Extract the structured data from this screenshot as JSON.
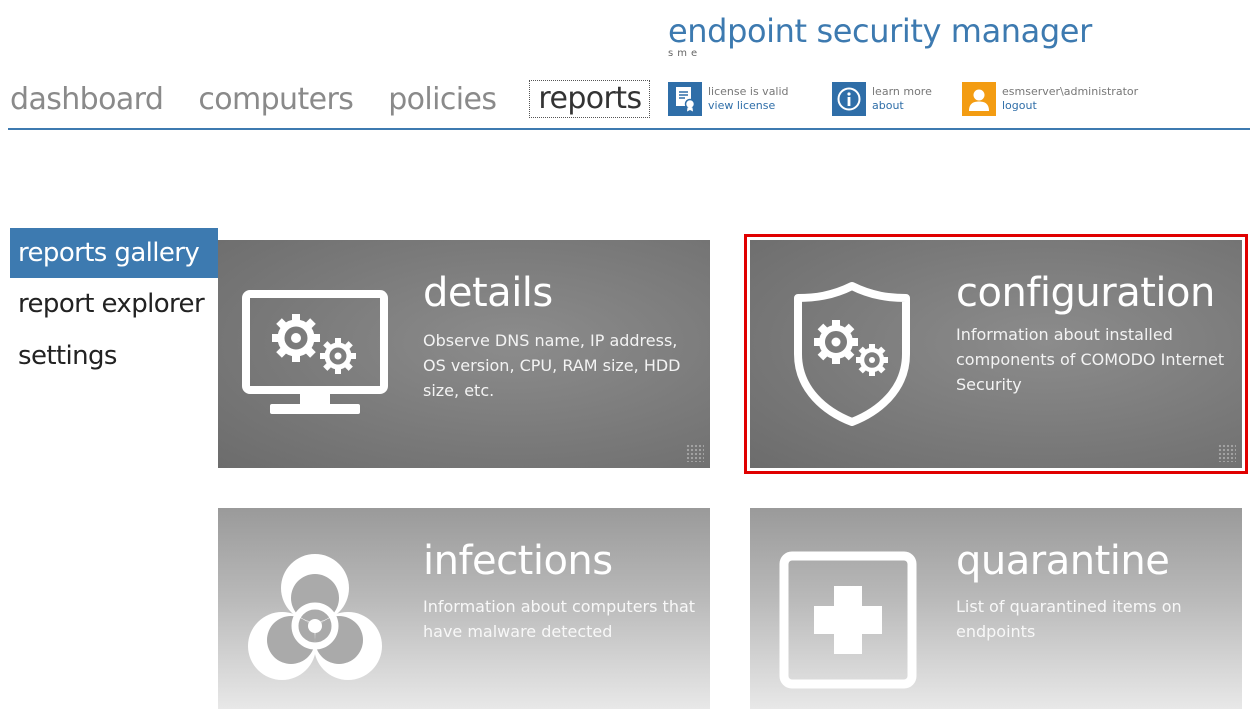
{
  "brand": {
    "title": "endpoint security manager",
    "subtitle": "sme"
  },
  "nav": [
    {
      "label": "dashboard",
      "active": false
    },
    {
      "label": "computers",
      "active": false
    },
    {
      "label": "policies",
      "active": false
    },
    {
      "label": "reports",
      "active": true
    }
  ],
  "header": {
    "license": {
      "status": "license is valid",
      "link": "view license",
      "icon": "certificate-icon"
    },
    "about": {
      "status": "learn more",
      "link": "about",
      "icon": "info-icon"
    },
    "user": {
      "name": "esmserver\\administrator",
      "link": "logout",
      "icon": "user-icon"
    }
  },
  "sidebar": {
    "items": [
      {
        "label": "reports gallery",
        "active": true
      },
      {
        "label": "report explorer",
        "active": false
      },
      {
        "label": "settings",
        "active": false
      }
    ]
  },
  "tiles": [
    {
      "title": "details",
      "description": "Observe DNS name, IP address, OS version, CPU, RAM size, HDD size, etc.",
      "icon": "monitor-gears-icon",
      "selected": false
    },
    {
      "title": "configuration",
      "description": "Information about installed components of COMODO Internet Security",
      "icon": "shield-gears-icon",
      "selected": true
    },
    {
      "title": "infections",
      "description": "Information about computers that have malware detected",
      "icon": "biohazard-icon",
      "selected": false
    },
    {
      "title": "quarantine",
      "description": "List of quarantined items on endpoints",
      "icon": "medical-cross-icon",
      "selected": false
    }
  ],
  "colors": {
    "accent": "#3d7ab0",
    "selection": "#e00000",
    "user_icon_bg": "#f39c12"
  }
}
